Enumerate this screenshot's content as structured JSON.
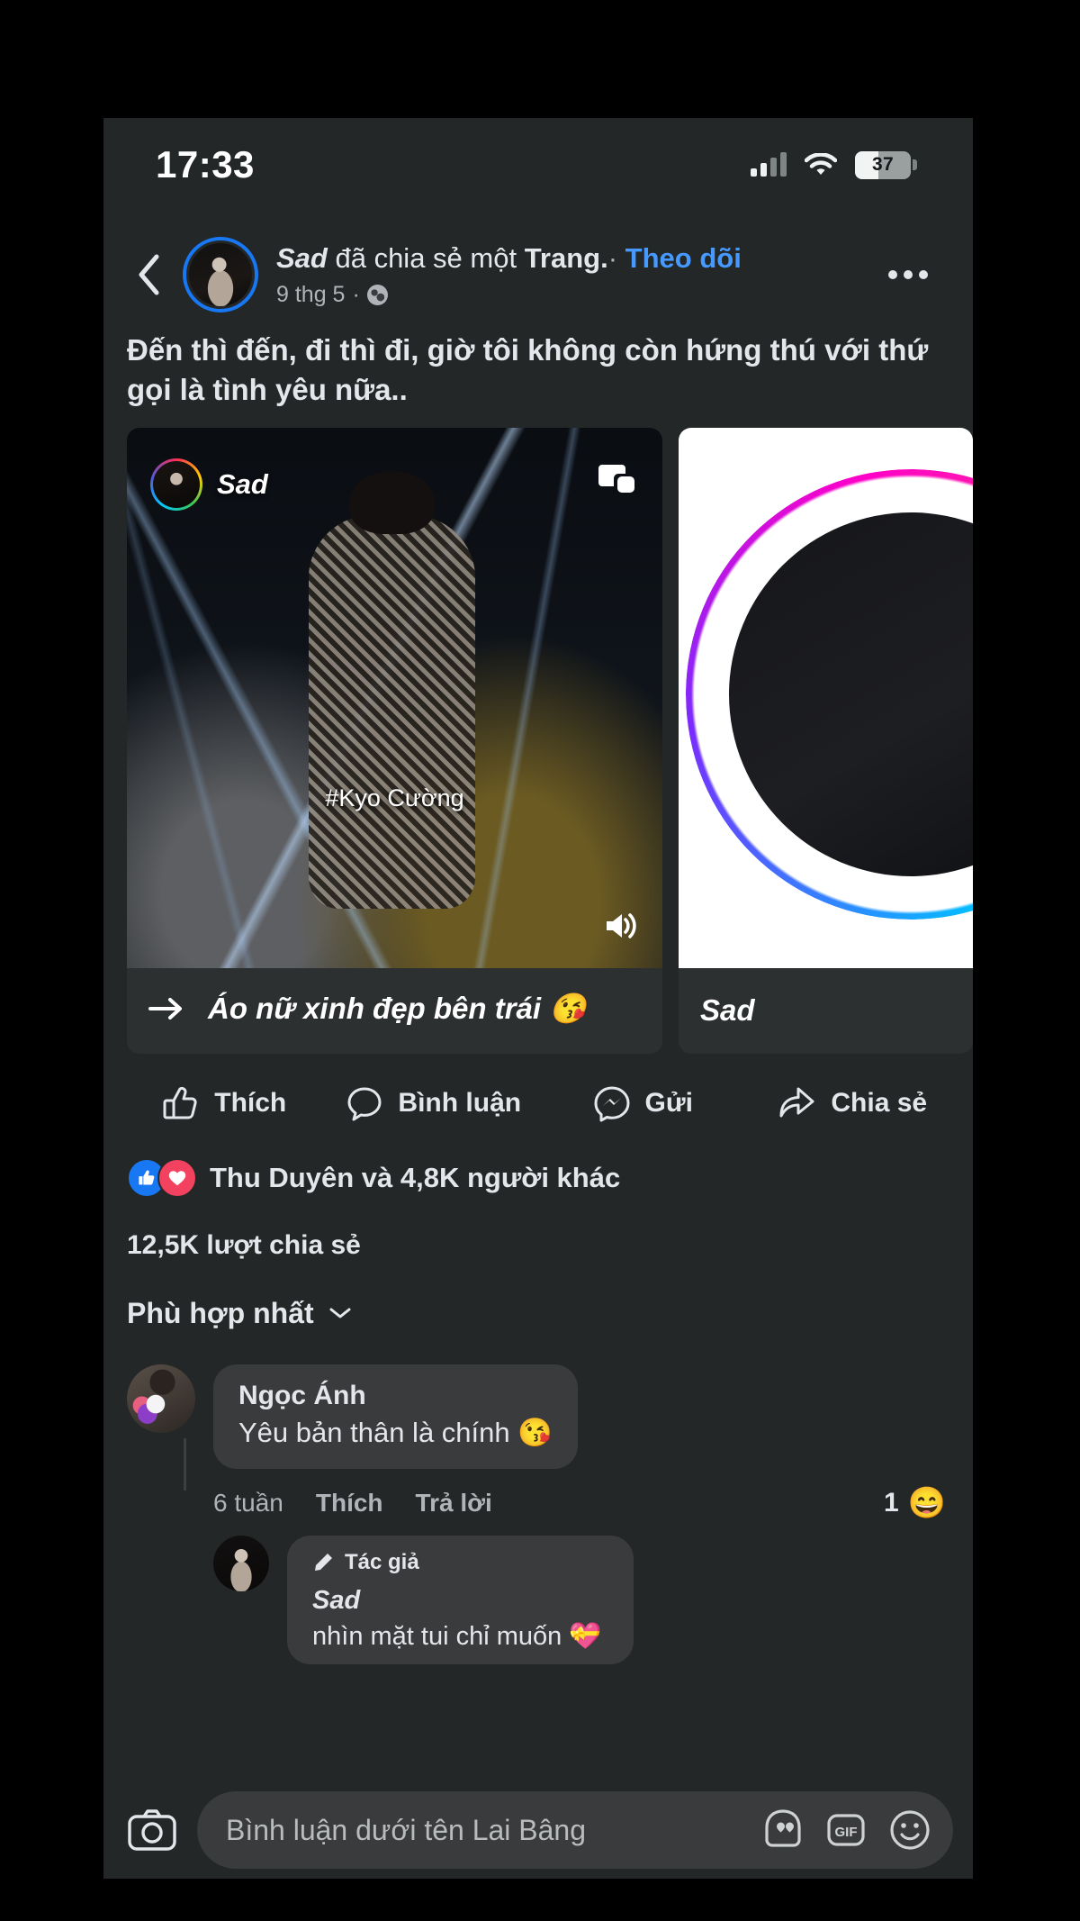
{
  "status_bar": {
    "time": "17:33",
    "battery_percent": "37",
    "signal_icon": "cellular-signal-icon",
    "wifi_icon": "wifi-icon",
    "battery_icon": "battery-icon"
  },
  "post_header": {
    "back_icon": "chevron-left-icon",
    "author_name": "Sad",
    "action_text": " đã chia sẻ một ",
    "shared_type": "Trang.",
    "separator": "·",
    "follow_label": "Theo dõi",
    "timestamp": "9 thg 5",
    "meta_separator": "·",
    "privacy_icon": "globe-icon",
    "menu_icon": "more-options-icon"
  },
  "post": {
    "text": "Đến thì đến, đi thì đi, giờ tôi không còn hứng thú với thứ gọi là tình yêu nữa.."
  },
  "media": {
    "main_card": {
      "overlay_user": "Sad",
      "pip_icon": "picture-in-picture-icon",
      "watermark": "#Kyo Cường",
      "sound_icon": "sound-on-icon",
      "caption_arrow_icon": "arrow-right-icon",
      "caption": "Áo nữ xinh đẹp bên trái 😘"
    },
    "side_card": {
      "label": "Sad"
    }
  },
  "actions": [
    {
      "label": "Thích",
      "icon": "thumbs-up-icon"
    },
    {
      "label": "Bình luận",
      "icon": "comment-bubble-icon"
    },
    {
      "label": "Gửi",
      "icon": "messenger-send-icon"
    },
    {
      "label": "Chia sẻ",
      "icon": "share-arrow-icon"
    }
  ],
  "engagement": {
    "reaction_like_icon": "like-reaction-icon",
    "reaction_love_icon": "love-reaction-icon",
    "reactions_text": "Thu Duyên và 4,8K người khác",
    "shares_text": "12,5K lượt chia sẻ"
  },
  "comments_section": {
    "sort_label": "Phù hợp nhất",
    "sort_chevron_icon": "chevron-down-icon",
    "comments": [
      {
        "name": "Ngọc Ánh",
        "body": "Yêu bản thân là chính 😘",
        "time": "6 tuần",
        "like_label": "Thích",
        "reply_label": "Trả lời",
        "reaction_count": "1",
        "reaction_emoji": "😄"
      }
    ],
    "reply": {
      "author_badge": "Tác giả",
      "author_badge_icon": "pen-icon",
      "name": "Sad",
      "body": "nhìn mặt tui chỉ muốn 💝"
    }
  },
  "composer": {
    "camera_icon": "camera-icon",
    "placeholder": "Bình luận dưới tên Lai Bâng",
    "avatar_sticker_icon": "avatar-sticker-icon",
    "gif_label": "GIF",
    "emoji_icon": "emoji-smiley-icon"
  },
  "colors": {
    "background": "#232727",
    "accent_blue": "#1877f2",
    "link_blue": "#4599ff",
    "love_red": "#f3425f",
    "text_primary": "#e4e6eb",
    "text_secondary": "#b0b3b8"
  }
}
